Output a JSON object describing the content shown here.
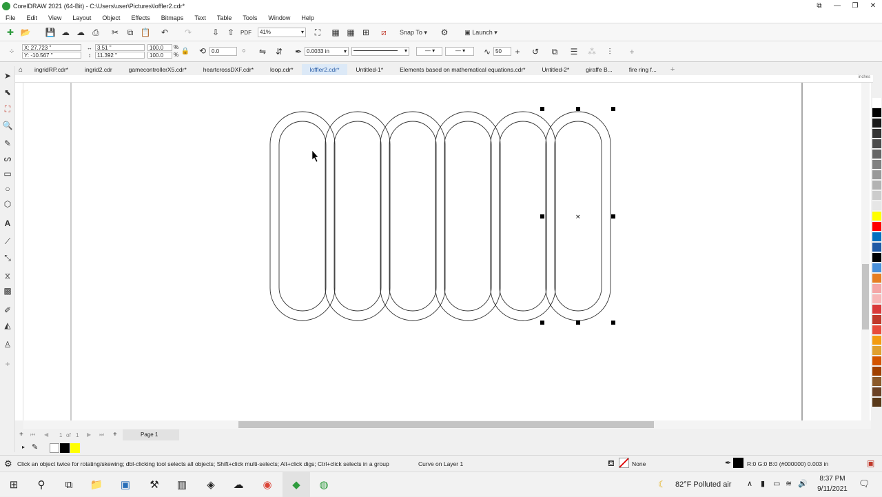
{
  "title_bar": {
    "title": "CorelDRAW 2021 (64-Bit) - C:\\Users\\user\\Pictures\\loffler2.cdr*"
  },
  "menu": [
    "File",
    "Edit",
    "View",
    "Layout",
    "Object",
    "Effects",
    "Bitmaps",
    "Text",
    "Table",
    "Tools",
    "Window",
    "Help"
  ],
  "toolbar": {
    "zoom": "41%",
    "snap_to": "Snap To",
    "launch": "Launch"
  },
  "property_bar": {
    "x": "X: 27.723 \"",
    "y": "Y: -10.567 \"",
    "width": "3.51 \"",
    "height": "11.392 \"",
    "scale_w": "100.0",
    "scale_h": "100.0",
    "pct1": "%",
    "pct2": "%",
    "rotation": "0.0",
    "outline_width": "0.0033 in",
    "smoothing": "50"
  },
  "doc_tabs": [
    {
      "label": "ingridRP.cdr*"
    },
    {
      "label": "ingrid2.cdr"
    },
    {
      "label": "gamecontrollerX5.cdr*"
    },
    {
      "label": "heartcrossDXF.cdr*"
    },
    {
      "label": "loop.cdr*"
    },
    {
      "label": "loffler2.cdr*",
      "active": true
    },
    {
      "label": "Untitled-1*"
    },
    {
      "label": "Elements based on mathematical equations.cdr*"
    },
    {
      "label": "Untitled-2*"
    },
    {
      "label": "giraffe B..."
    },
    {
      "label": "fire ring f..."
    }
  ],
  "ruler_unit": "inches",
  "page_nav": {
    "current": "1",
    "of": "of",
    "total": "1",
    "page_tab": "Page 1"
  },
  "status": {
    "hint": "Click an object twice for rotating/skewing; dbl-clicking tool selects all objects; Shift+click multi-selects; Alt+click digs; Ctrl+click selects in a group",
    "object": "Curve on Layer 1",
    "fill": "None",
    "outline": "R:0 G:0 B:0 (#000000)  0.003 in"
  },
  "taskbar": {
    "weather": "82°F  Polluted air",
    "time": "8:37 PM",
    "date": "9/11/2021"
  },
  "palette_colors": [
    "#ffffff",
    "#000000",
    "#1a1a1a",
    "#333333",
    "#4d4d4d",
    "#666666",
    "#808080",
    "#999999",
    "#b3b3b3",
    "#cccccc",
    "#e6e6e6",
    "#ffff00",
    "#ff0000",
    "#0070c0",
    "#1f5aa6",
    "#000000",
    "#4a90d9",
    "#e67e22",
    "#f4a6a6",
    "#f7b7b7",
    "#d93a3a",
    "#c0392b",
    "#e74c3c",
    "#f39c12",
    "#e0a030",
    "#d35400",
    "#a04000",
    "#8b5a2b",
    "#6b4226",
    "#5a3a1a"
  ],
  "fill_swatches": [
    "#000000",
    "#ffff00"
  ]
}
